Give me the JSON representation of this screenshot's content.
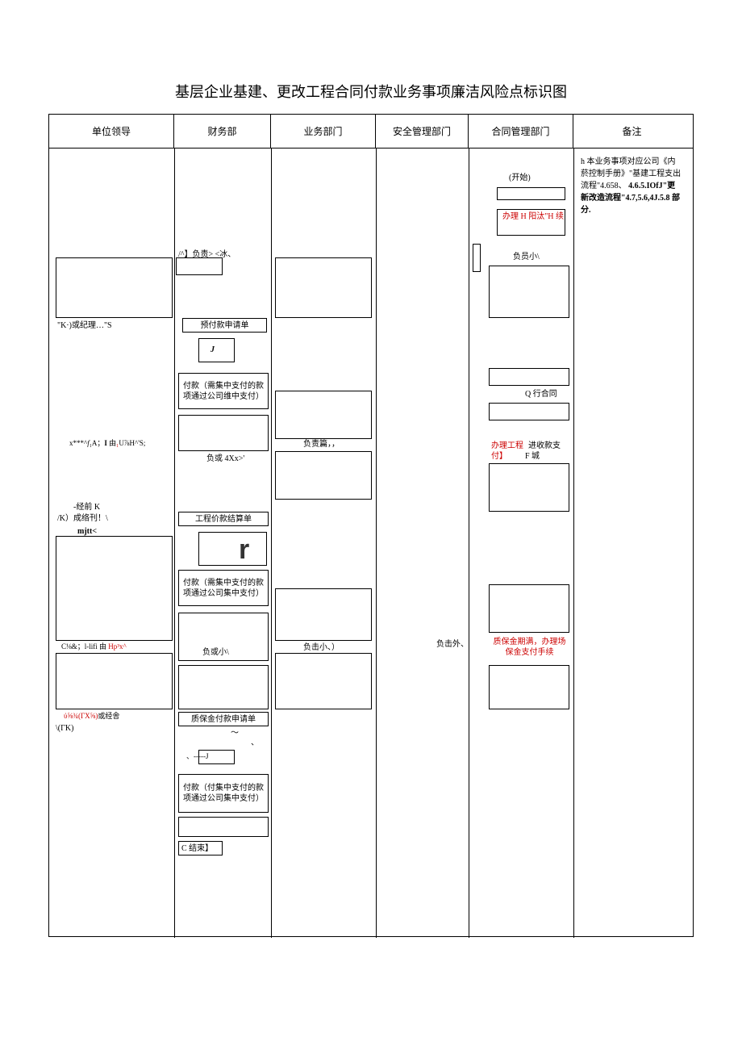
{
  "title": "基层企业基建、更改工程合同付款业务事项廉洁风险点标识图",
  "headers": {
    "col1": "单位领导",
    "col2": "财务部",
    "col3": "业务部门",
    "col4": "安全管理部门",
    "col5": "合同管理部门",
    "col6": "备注"
  },
  "nodes": {
    "start": "(开始)",
    "handle_h": "办理 H 阳汰\"H 续",
    "fuze_bing": "/^】负责> <冰、",
    "fuyuan": "负员小\\",
    "kj_or": "\"K·)或纪理…\"S",
    "prepay_apply": "预付款申请单",
    "j_char": "J",
    "pay1": "付款（需集中支付的款项通过公司维中支付）",
    "q_contract": "Q 行合同",
    "xf_line": "x***^f₁A；I 由₁U⅞H^'S;",
    "fuze_pian": "负责篇，，",
    "handle_proj": "办理工程",
    "jin_shou": "进收款支付】",
    "f_cheng": "F 城",
    "fu_4x": "负或 4Xx>'",
    "jingqian": "-经前 K",
    "k_cheng": "/K）成络刊！\\",
    "mjtt": "mjtt<",
    "settlement": "工程价款结算单",
    "r_char": "r",
    "pay2": "付款（需集中支付的款项通过公司集中支付）",
    "c_hifi": "C⅛&；l-lifi 由",
    "hps": "Hp³x^",
    "fu_xiao": "负或小\\",
    "fuji_xiao": "负击小、）",
    "fuji_wai": "负击外、",
    "baojin_text": "质保金期满，办理场保金支付手续",
    "lambda_line": "ὐ⅝¾(ΓX⅝)或经舎",
    "gamma_k": "\\(ΓK)",
    "baojin_apply": "质保金付款申请单",
    "tilde1": "～",
    "tilde2": "、",
    "arrow_j": "、-----J",
    "pay3": "付款（付集中支付的款项通过公司集中支付）",
    "end": "C 结束】"
  },
  "notes_text": {
    "line1": "h 本业务事项对应公司《内菸控制手册》\"基建工程支出流程\"4.658、",
    "line2": "4.6.5.IOfJ\"更新改造流程\"4.7,5.6,4J.5.8 部分."
  }
}
